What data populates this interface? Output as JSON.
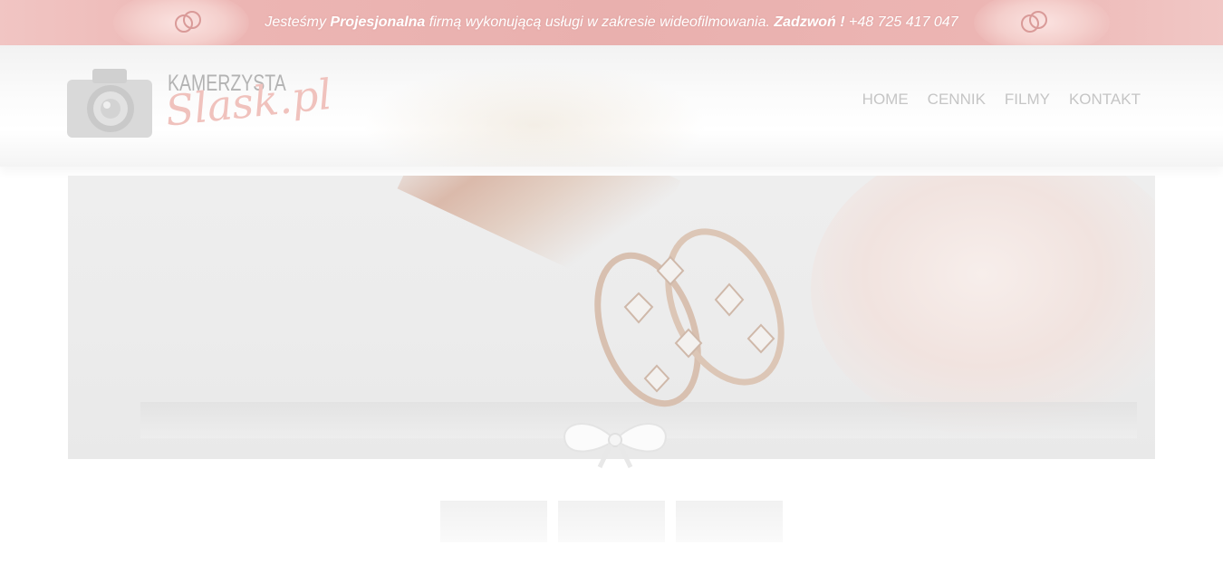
{
  "top_bar": {
    "text_part1": "Jesteśmy ",
    "text_bold1": "Projesjonalna",
    "text_part2": " firmą wykonującą usługi w zakresie wideofilmowania. ",
    "text_bold2": "Zadzwoń !",
    "text_part3": " +48 725 417 047"
  },
  "logo": {
    "line1": "KAMERZYSTA",
    "line2": "Slask.pl"
  },
  "nav": {
    "items": [
      "HOME",
      "CENNIK",
      "FILMY",
      "KONTAKT"
    ]
  },
  "colors": {
    "top_bar": "#e9b0ae",
    "nav_text": "#c5c5c5",
    "logo_accent": "#f0c2bd"
  }
}
